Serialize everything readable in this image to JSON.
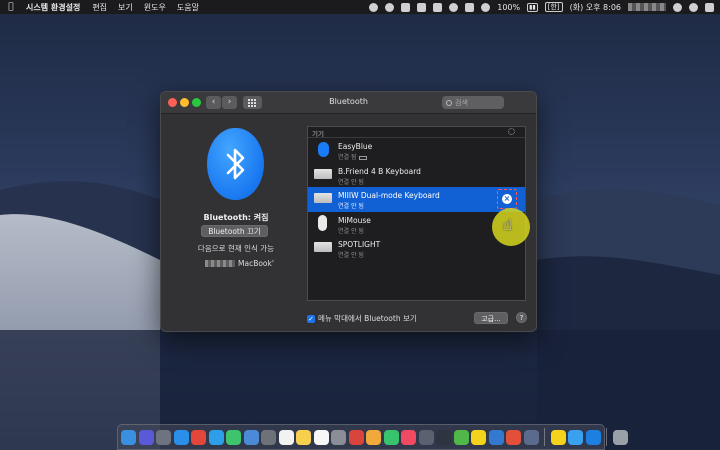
{
  "menubar": {
    "app_name": "시스템 환경설정",
    "menus": [
      "편집",
      "보기",
      "윈도우",
      "도움말"
    ],
    "battery": "100%",
    "input_source": "[한]",
    "clock": "(화) 오후 8:06"
  },
  "window": {
    "title": "Bluetooth",
    "search_placeholder": "검색"
  },
  "bluetooth": {
    "status": "Bluetooth: 켜짐",
    "toggle_label": "Bluetooth 끄기",
    "discoverable": "다음으로 현재 인식 가능",
    "device_name": "MacBook'"
  },
  "devices": {
    "header": "기기",
    "items": [
      {
        "name": "EasyBlue",
        "status": "연결 됨",
        "icon": "bluetooth-device-icon",
        "selected": false
      },
      {
        "name": "B.Friend 4 B Keyboard",
        "status": "연결 안 됨",
        "icon": "keyboard-icon",
        "selected": false
      },
      {
        "name": "MIIIW Dual-mode Keyboard",
        "status": "연결 안 됨",
        "icon": "keyboard-icon",
        "selected": true
      },
      {
        "name": "MiMouse",
        "status": "연결 안 됨",
        "icon": "mouse-icon",
        "selected": false
      },
      {
        "name": "SPOTLIGHT",
        "status": "연결 안 됨",
        "icon": "keyboard-icon",
        "selected": false
      }
    ]
  },
  "footer": {
    "menu_checkbox_label": "메뉴 막대에서 Bluetooth 보기",
    "menu_checkbox_checked": true,
    "advanced_label": "고급...",
    "help_label": "?"
  },
  "colors": {
    "accent": "#1261d4",
    "bluetooth_blue": "#1978f0",
    "cursor_highlight": "#d6d61e"
  }
}
